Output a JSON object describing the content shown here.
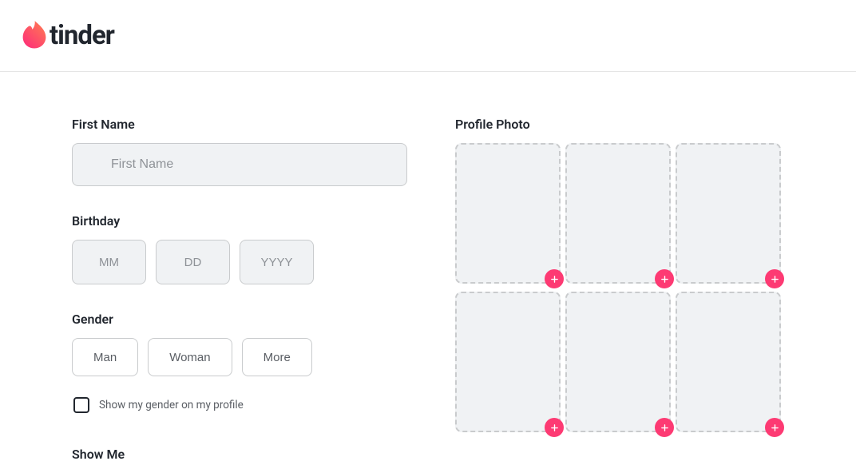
{
  "brand": {
    "name": "tinder"
  },
  "form": {
    "firstName": {
      "label": "First Name",
      "placeholder": "First Name",
      "value": ""
    },
    "birthday": {
      "label": "Birthday",
      "month": {
        "placeholder": "MM",
        "value": ""
      },
      "day": {
        "placeholder": "DD",
        "value": ""
      },
      "year": {
        "placeholder": "YYYY",
        "value": ""
      }
    },
    "gender": {
      "label": "Gender",
      "options": [
        "Man",
        "Woman",
        "More"
      ],
      "showOnProfileLabel": "Show my gender on my profile",
      "showOnProfileChecked": false
    },
    "showMe": {
      "label": "Show Me"
    }
  },
  "profilePhoto": {
    "label": "Profile Photo",
    "slots": 6
  },
  "colors": {
    "accent": "#fd3a73",
    "accentGradientStart": "#fd297b",
    "accentGradientEnd": "#ff7854"
  }
}
